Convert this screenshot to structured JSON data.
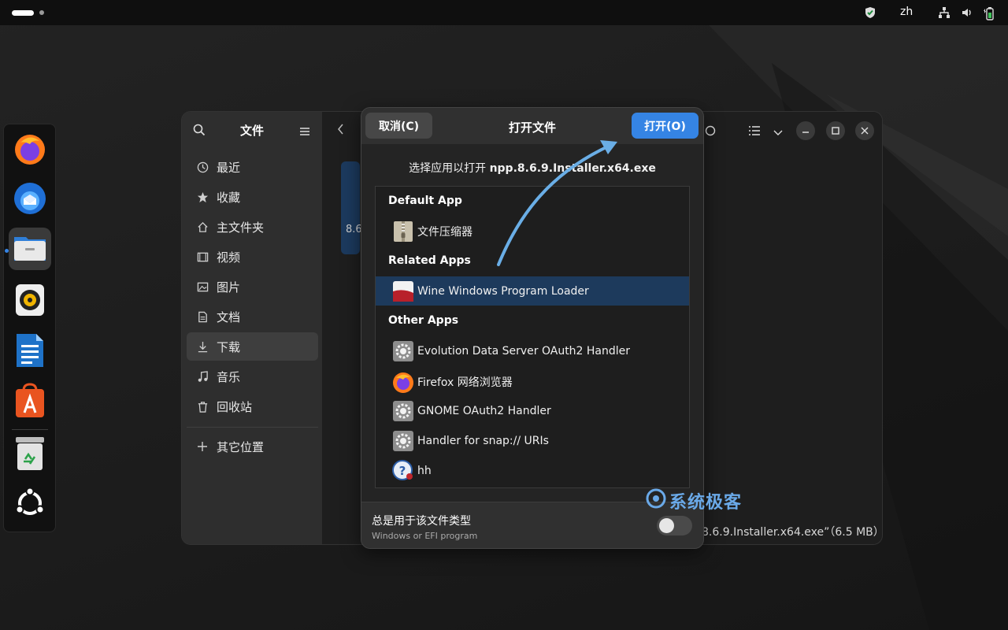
{
  "topbar": {
    "language": "zh",
    "icons": [
      "shield-icon",
      "network-icon",
      "volume-icon",
      "battery-icon"
    ]
  },
  "dock": {
    "items": [
      {
        "name": "firefox",
        "icon": "firefox-icon"
      },
      {
        "name": "thunderbird",
        "icon": "thunderbird-icon"
      },
      {
        "name": "files",
        "icon": "files-icon",
        "active": true
      },
      {
        "name": "rhythmbox",
        "icon": "rhythmbox-icon"
      },
      {
        "name": "libreoffice-writer",
        "icon": "writer-icon"
      },
      {
        "name": "app-center",
        "icon": "app-center-icon"
      },
      {
        "name": "trash",
        "icon": "trash-icon"
      },
      {
        "name": "show-apps",
        "icon": "ubuntu-apps-icon"
      }
    ]
  },
  "file_manager": {
    "sidebar_title": "文件",
    "sidebar_items": [
      {
        "label": "最近",
        "icon": "clock-icon"
      },
      {
        "label": "收藏",
        "icon": "star-icon"
      },
      {
        "label": "主文件夹",
        "icon": "home-icon"
      },
      {
        "label": "视频",
        "icon": "video-icon"
      },
      {
        "label": "图片",
        "icon": "image-icon"
      },
      {
        "label": "文档",
        "icon": "document-icon"
      },
      {
        "label": "下载",
        "icon": "download-icon",
        "selected": true
      },
      {
        "label": "音乐",
        "icon": "music-icon"
      },
      {
        "label": "回收站",
        "icon": "trash-icon"
      }
    ],
    "other_locations": "其它位置",
    "thumb_text": "8.6",
    "status_text": "8.6.9.Installer.x64.exe”（6.5 MB）"
  },
  "dialog": {
    "cancel_label": "取消(C)",
    "title": "打开文件",
    "open_label": "打开(O)",
    "subtitle_prefix": "选择应用以打开 ",
    "subtitle_file": "npp.8.6.9.Installer.x64.exe",
    "sections": {
      "default": "Default App",
      "related": "Related Apps",
      "other": "Other Apps"
    },
    "default_apps": [
      {
        "label": "文件压缩器",
        "icon": "archive-icon"
      }
    ],
    "related_apps": [
      {
        "label": "Wine Windows Program Loader",
        "icon": "wine-icon",
        "selected": true
      }
    ],
    "other_apps": [
      {
        "label": "Evolution Data Server OAuth2 Handler",
        "icon": "gear-icon"
      },
      {
        "label": "Firefox 网络浏览器",
        "icon": "firefox-icon"
      },
      {
        "label": "GNOME OAuth2 Handler",
        "icon": "gear-icon"
      },
      {
        "label": "Handler for snap:// URIs",
        "icon": "gear-icon"
      },
      {
        "label": "hh",
        "icon": "help-icon"
      }
    ],
    "footer_label": "总是用于该文件类型",
    "footer_sub": "Windows or EFI program",
    "always_use_enabled": false
  },
  "watermark": "系统极客",
  "colors": {
    "accent": "#3584e4",
    "selection": "#1d3a5c",
    "annotation_arrow": "#6aaee6"
  }
}
